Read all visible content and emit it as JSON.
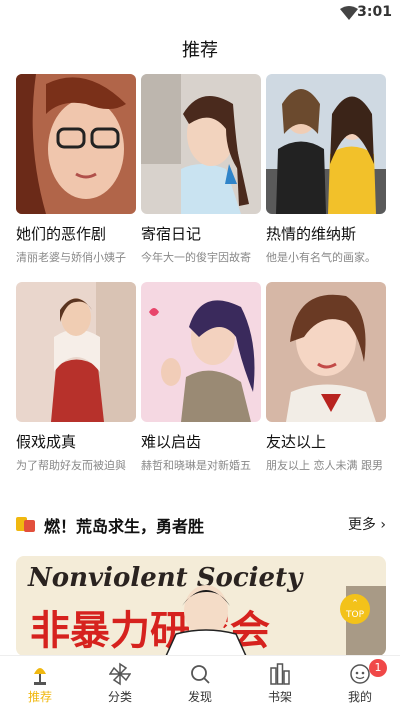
{
  "status_bar": {
    "time": "3:01"
  },
  "header": {
    "title": "推荐"
  },
  "cards": [
    {
      "title": "她们的恶作剧",
      "desc": "清丽老婆与娇俏小姨子"
    },
    {
      "title": "寄宿日记",
      "desc": "今年大一的俊宇因故寄"
    },
    {
      "title": "热情的维纳斯",
      "desc": "他是小有名气的画家。"
    },
    {
      "title": "假戏成真",
      "desc": "为了帮助好友而被迫與"
    },
    {
      "title": "难以启齿",
      "desc": "赫哲和晓琳是对新婚五"
    },
    {
      "title": "友达以上",
      "desc": "朋友以上 恋人未满 跟男"
    }
  ],
  "section": {
    "title": "燃！荒岛求生，勇者胜",
    "more": "更多"
  },
  "banner": {
    "line1": "Nonviolent Society",
    "line2": "非暴力研究会"
  },
  "top_button": {
    "label": "TOP"
  },
  "tabbar": {
    "items": [
      {
        "label": "推荐"
      },
      {
        "label": "分类"
      },
      {
        "label": "发现"
      },
      {
        "label": "书架"
      },
      {
        "label": "我的"
      }
    ],
    "badge": "1"
  },
  "colors": {
    "accent": "#f0b810",
    "badge": "#f04848"
  }
}
